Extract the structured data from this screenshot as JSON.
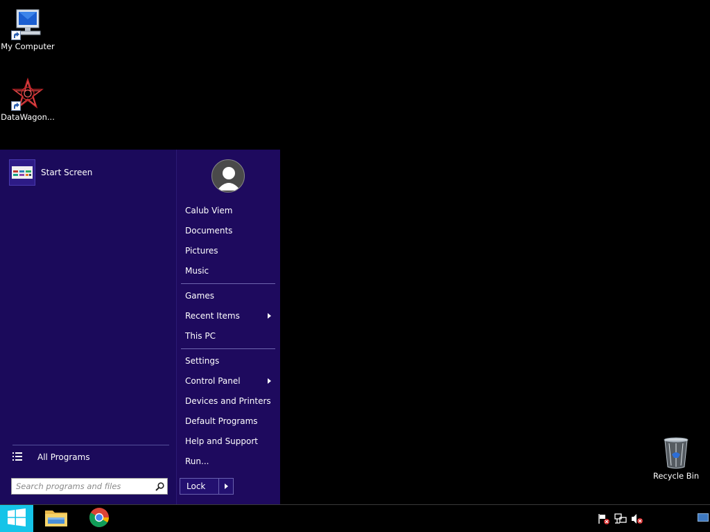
{
  "desktop": {
    "icons": [
      {
        "label": "My Computer",
        "icon": "my-computer-icon"
      },
      {
        "label": "DataWagon...",
        "icon": "datawagon-icon"
      },
      {
        "label": "Recycle Bin",
        "icon": "recycle-bin-icon"
      }
    ]
  },
  "start_menu": {
    "pinned": [
      {
        "label": "Start Screen",
        "icon": "start-screen-icon"
      }
    ],
    "all_programs_label": "All Programs",
    "search": {
      "placeholder": "Search programs and files",
      "value": ""
    },
    "right_links": [
      {
        "label": "Calub Viem"
      },
      {
        "label": "Documents"
      },
      {
        "label": "Pictures"
      },
      {
        "label": "Music"
      },
      {
        "label": "Games"
      },
      {
        "label": "Recent Items",
        "has_submenu": true
      },
      {
        "label": "This PC"
      },
      {
        "label": "Settings"
      },
      {
        "label": "Control Panel",
        "has_submenu": true
      },
      {
        "label": "Devices and Printers"
      },
      {
        "label": "Default Programs"
      },
      {
        "label": "Help and Support"
      },
      {
        "label": "Run..."
      }
    ],
    "power_button_label": "Lock"
  },
  "taskbar": {
    "apps": [
      {
        "name": "file-explorer-icon"
      },
      {
        "name": "chrome-icon"
      }
    ],
    "tray": [
      "action-center-flag-icon",
      "network-icon",
      "volume-muted-icon"
    ]
  },
  "colors": {
    "start_menu_bg": "#1b0a5b",
    "start_button": "#15c4e8",
    "desktop_bg": "#000000"
  }
}
